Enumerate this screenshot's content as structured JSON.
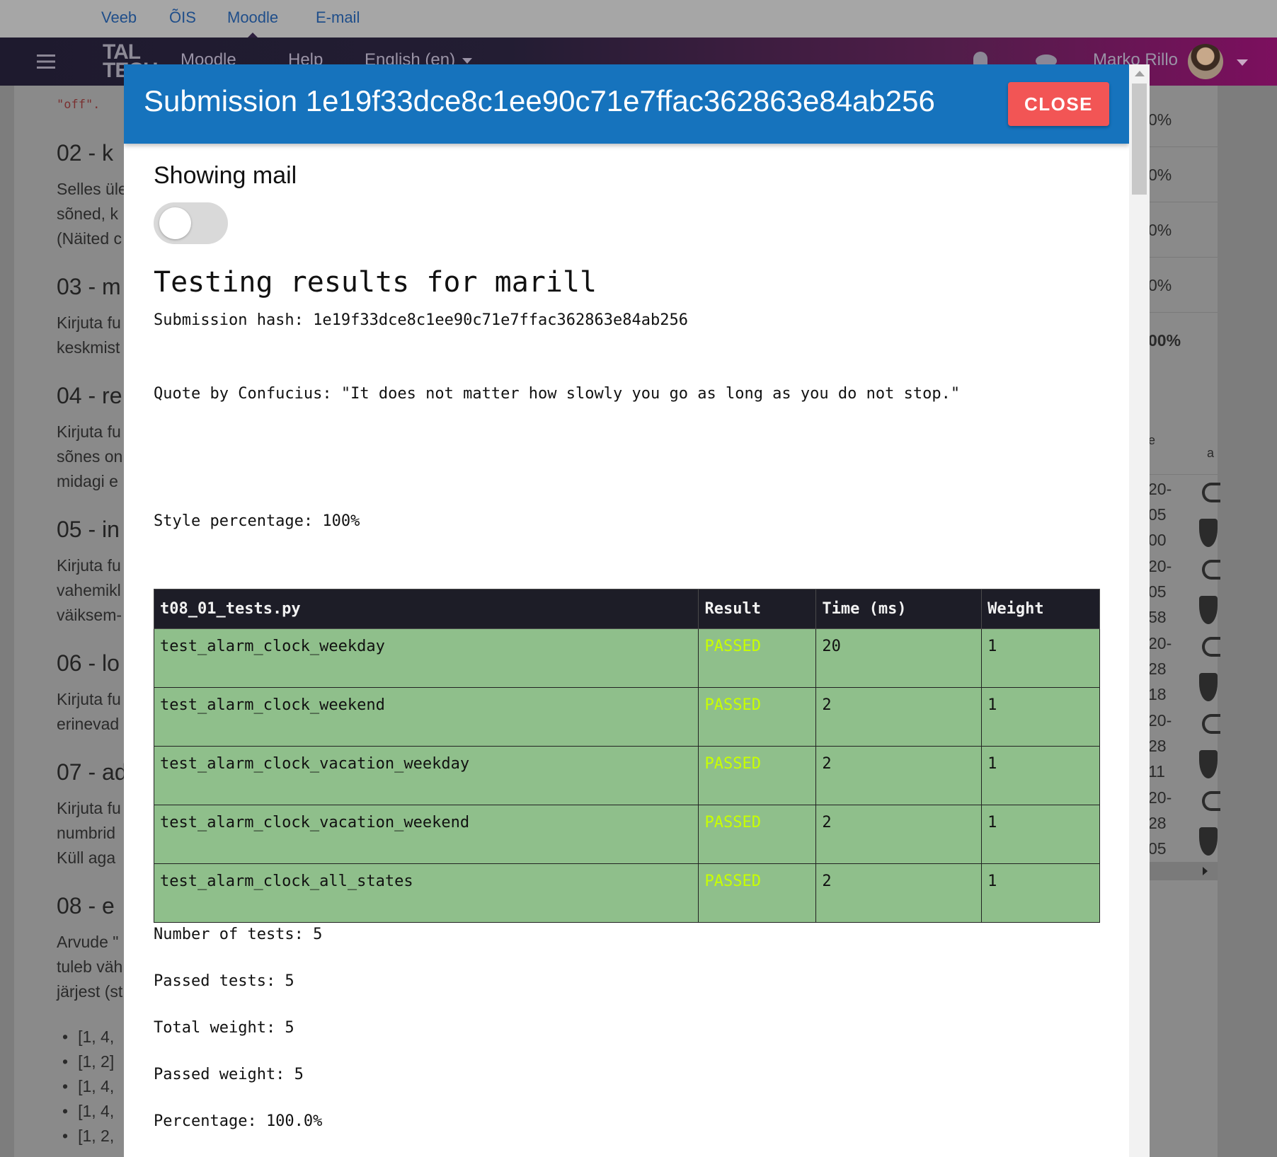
{
  "topbar": {
    "links": [
      "Veeb",
      "ÕIS",
      "Moodle",
      "E-mail"
    ]
  },
  "navbar": {
    "logo": "TAL TECH",
    "items": [
      "Moodle",
      "Help",
      "English (en)"
    ],
    "user_name": "Marko Rillo"
  },
  "background": {
    "code_snippet": "\"off\".",
    "sections": [
      {
        "heading": "02 - k",
        "lines": [
          "Selles üle",
          "sõned, k",
          "(Näited c"
        ]
      },
      {
        "heading": "03 - m",
        "lines": [
          "Kirjuta fu",
          "keskmist"
        ]
      },
      {
        "heading": "04 - re",
        "lines": [
          "Kirjuta fu",
          "sõnes on",
          "midagi e"
        ]
      },
      {
        "heading": "05 - in",
        "lines": [
          "Kirjuta fu",
          "vahemikl",
          "väiksem-"
        ]
      },
      {
        "heading": "06 - lo",
        "lines": [
          "Kirjuta fu",
          "erinevad"
        ]
      },
      {
        "heading": "07 - ad",
        "lines": [
          "Kirjuta fu",
          "numbrid",
          "Küll aga"
        ]
      },
      {
        "heading": "08 - e",
        "lines": [
          "Arvude \"",
          "tuleb väh",
          "järjest (st"
        ]
      }
    ],
    "list_items": [
      "[1, 4,",
      "[1, 2]",
      "[1, 4,",
      "[1, 4,",
      "[1, 2,"
    ],
    "right_percents": [
      "0%",
      "0%",
      "0%",
      "0%",
      "00%"
    ],
    "right_header": "e",
    "right_header2": "a",
    "right_numbers": [
      "20-",
      "05",
      "00",
      "20-",
      "05",
      "58",
      "20-",
      "28",
      "18",
      "20-",
      "28",
      "11",
      "20-",
      "28",
      "05"
    ]
  },
  "modal": {
    "title": "Submission 1e19f33dce8c1ee90c71e7ffac362863e84ab256",
    "close_label": "CLOSE",
    "showing_mail_label": "Showing mail",
    "showing_mail_on": false,
    "results_title": "Testing results for marill",
    "submission_hash_line": "Submission hash: 1e19f33dce8c1ee90c71e7ffac362863e84ab256",
    "quote_line": "Quote by Confucius: \"It does not matter how slowly you go as long as you do not stop.\"",
    "style_line": "Style percentage: 100%",
    "table": {
      "headers": [
        "t08_01_tests.py",
        "Result",
        "Time (ms)",
        "Weight"
      ],
      "rows": [
        {
          "name": "test_alarm_clock_weekday",
          "result": "PASSED",
          "time": "20",
          "weight": "1"
        },
        {
          "name": "test_alarm_clock_weekend",
          "result": "PASSED",
          "time": "2",
          "weight": "1"
        },
        {
          "name": "test_alarm_clock_vacation_weekday",
          "result": "PASSED",
          "time": "2",
          "weight": "1"
        },
        {
          "name": "test_alarm_clock_vacation_weekend",
          "result": "PASSED",
          "time": "2",
          "weight": "1"
        },
        {
          "name": "test_alarm_clock_all_states",
          "result": "PASSED",
          "time": "2",
          "weight": "1"
        }
      ]
    },
    "summary": {
      "number_of_tests": "Number of tests: 5",
      "passed_tests": "Passed tests: 5",
      "total_weight": "Total weight: 5",
      "passed_weight": "Passed weight: 5",
      "percentage": "Percentage: 100.0%"
    },
    "colors": {
      "header": "#1673bd",
      "close": "#f25555",
      "row_pass": "#8fbf8b",
      "passed_text": "#c8ff00"
    }
  }
}
